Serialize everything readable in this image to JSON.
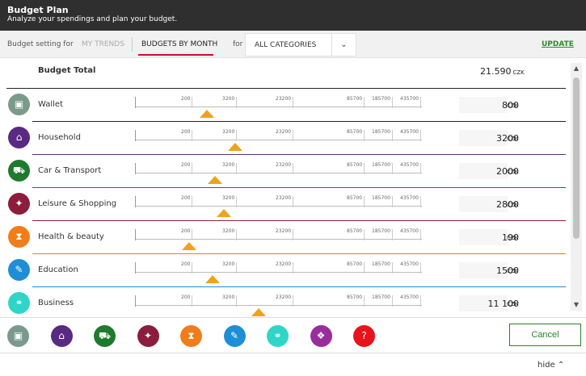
{
  "header": {
    "title": "Budget Plan",
    "subtitle": "Analyze your spendings and plan your budget."
  },
  "tabs": {
    "setting_label": "Budget setting for",
    "my_trends": "MY TRENDS",
    "budgets_by_month": "BUDGETS BY MONTH",
    "for_label": "for",
    "category_value": "ALL CATEGORIES",
    "update": "UPDATE"
  },
  "total": {
    "label": "Budget Total",
    "amount": "21.590",
    "currency": "CZK"
  },
  "tick_labels": [
    "200",
    "3200",
    "23200",
    "85700",
    "185700",
    "435700"
  ],
  "rows": [
    {
      "name": "Wallet",
      "amount": "800",
      "currency": "CZK",
      "color": "#7a9a8c",
      "icon": "wallet-icon",
      "glyph": "▣",
      "slider_level": 0.25,
      "line_color": "#222222"
    },
    {
      "name": "Household",
      "amount": "3200",
      "currency": "CZK",
      "color": "#5a2a82",
      "icon": "household-icon",
      "glyph": "⌂",
      "slider_level": 0.35,
      "line_color": "#5a2a82"
    },
    {
      "name": "Car & Transport",
      "amount": "2000",
      "currency": "CZK",
      "color": "#1f7a2e",
      "icon": "car-icon",
      "glyph": "⛟",
      "slider_level": 0.28,
      "line_color": "#1f7a2e"
    },
    {
      "name": "Leisure & Shopping",
      "amount": "2800",
      "currency": "CZK",
      "color": "#8c1d3d",
      "icon": "ticket-icon",
      "glyph": "✦",
      "slider_level": 0.31,
      "line_color": "#8c1d3d"
    },
    {
      "name": "Health & beauty",
      "amount": "190",
      "currency": "CZK",
      "color": "#f07d1a",
      "icon": "hourglass-icon",
      "glyph": "⧗",
      "slider_level": 0.19,
      "line_color": "#f07d1a"
    },
    {
      "name": "Education",
      "amount": "1500",
      "currency": "CZK",
      "color": "#1e8fd6",
      "icon": "pen-icon",
      "glyph": "✎",
      "slider_level": 0.27,
      "line_color": "#1e8fd6"
    },
    {
      "name": "Business",
      "amount": "11 100",
      "currency": "CZK",
      "color": "#2fd6c8",
      "icon": "business-icon",
      "glyph": "⚭",
      "slider_level": 0.43,
      "line_color": "#2fd6c8"
    }
  ],
  "bottom_icons": [
    {
      "icon": "wallet-icon",
      "color": "#7a9a8c",
      "glyph": "▣"
    },
    {
      "icon": "household-icon",
      "color": "#5a2a82",
      "glyph": "⌂"
    },
    {
      "icon": "car-icon",
      "color": "#1f7a2e",
      "glyph": "⛟"
    },
    {
      "icon": "ticket-icon",
      "color": "#8c1d3d",
      "glyph": "✦"
    },
    {
      "icon": "hourglass-icon",
      "color": "#f07d1a",
      "glyph": "⧗"
    },
    {
      "icon": "pen-icon",
      "color": "#1e8fd6",
      "glyph": "✎"
    },
    {
      "icon": "business-icon",
      "color": "#2fd6c8",
      "glyph": "⚭"
    },
    {
      "icon": "gift-icon",
      "color": "#9b2d9b",
      "glyph": "❖"
    },
    {
      "icon": "question-icon",
      "color": "#e8141c",
      "glyph": "?"
    }
  ],
  "actions": {
    "cancel": "Cancel",
    "hide": "hide"
  },
  "colors": {
    "accent_green": "#2e7d32",
    "slider_handle": "#f0a21b",
    "active_tab_underline": "#c8102e"
  }
}
